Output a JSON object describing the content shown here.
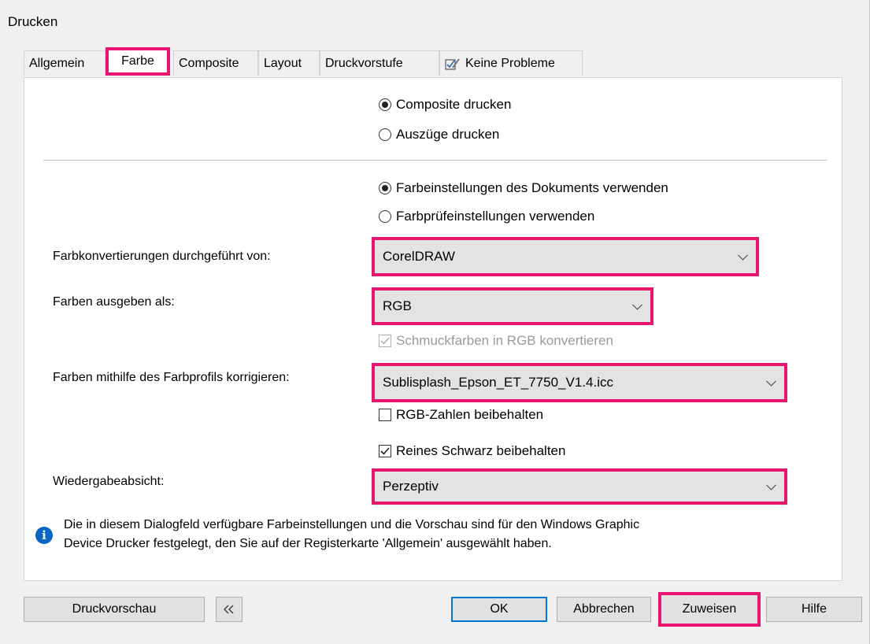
{
  "dialog": {
    "title": "Drucken"
  },
  "tabs": [
    {
      "label": "Allgemein"
    },
    {
      "label": "Farbe"
    },
    {
      "label": "Composite"
    },
    {
      "label": "Layout"
    },
    {
      "label": "Druckvorstufe"
    },
    {
      "label": "Keine Probleme",
      "icon": "checklist-icon"
    }
  ],
  "output_mode": {
    "composite_label": "Composite drucken",
    "separations_label": "Auszüge drucken",
    "selected": "composite"
  },
  "color_settings": {
    "document_label": "Farbeinstellungen des Dokuments verwenden",
    "proof_label": "Farbprüfeinstellungen verwenden",
    "selected": "document"
  },
  "fields": {
    "conversion_label": "Farbkonvertierungen durchgeführt von:",
    "conversion_value": "CorelDRAW",
    "output_label": "Farben ausgeben als:",
    "output_value": "RGB",
    "spot_label": "Schmuckfarben in RGB konvertieren",
    "spot_checked": true,
    "spot_disabled": true,
    "profile_label": "Farben mithilfe des Farbprofils korrigieren:",
    "profile_value": "Sublisplash_Epson_ET_7750_V1.4.icc",
    "keep_rgb_label": "RGB-Zahlen beibehalten",
    "keep_rgb_checked": false,
    "pure_black_label": "Reines Schwarz beibehalten",
    "pure_black_checked": true,
    "intent_label": "Wiedergabeabsicht:",
    "intent_value": "Perzeptiv"
  },
  "info": {
    "line1": "Die in diesem Dialogfeld verfügbare Farbeinstellungen und die Vorschau sind für den Windows Graphic",
    "line2": "Device Drucker festgelegt, den Sie auf der Registerkarte 'Allgemein' ausgewählt haben."
  },
  "buttons": {
    "preview": "Druckvorschau",
    "collapse_icon": "double-chevron-left-icon",
    "ok": "OK",
    "cancel": "Abbrechen",
    "apply": "Zuweisen",
    "help": "Hilfe"
  },
  "colors": {
    "highlight": "#e8166f",
    "accent": "#0078d7",
    "info_icon": "#0a66c2"
  }
}
